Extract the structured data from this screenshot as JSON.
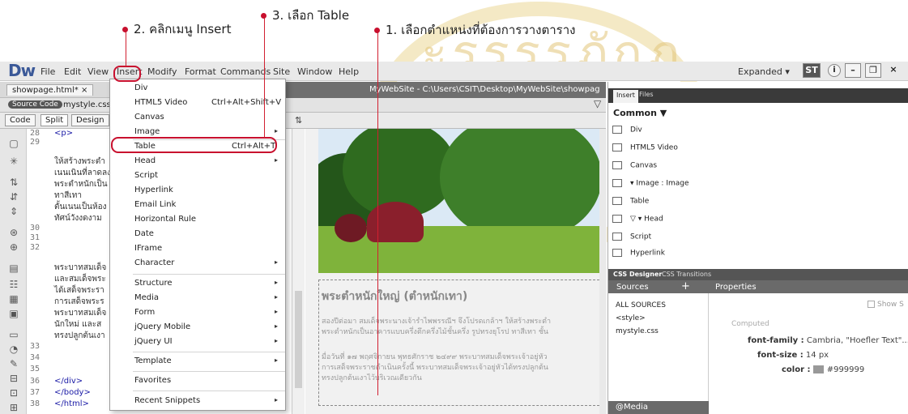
{
  "annotations": {
    "step2": "2. คลิกเมนู Insert",
    "step3": "3. เลือก Table",
    "step1": "1. เลือกตำแหน่งที่ต้องการวางตาราง"
  },
  "app": {
    "logo": "Dw",
    "menu": [
      "File",
      "Edit",
      "View",
      "Insert",
      "Modify",
      "Format",
      "Commands",
      "Site",
      "Window",
      "Help"
    ],
    "workspace": "Expanded",
    "workspace_arrow": "▾",
    "badge": "ST"
  },
  "doc": {
    "tab": "showpage.html*",
    "tab_close": "×",
    "path": "MyWebSite - C:\\Users\\CSIT\\Desktop\\MyWebSite\\showpage.html",
    "source_badge": "Source Code",
    "css_link": "mystyle.css"
  },
  "views": [
    "Code",
    "Split",
    "Design"
  ],
  "code": {
    "lines": [
      {
        "n": "28",
        "t": "<p>"
      },
      {
        "n": "29",
        "t": ""
      },
      {
        "n": "",
        "t": "ให้สร้างพระตำ"
      },
      {
        "n": "",
        "t": "เนนเนินที่ลาดลง"
      },
      {
        "n": "",
        "t": "พระตำหนักเป็น"
      },
      {
        "n": "",
        "t": "ทาสีเทา"
      },
      {
        "n": "",
        "t": "ตั้นเนนเป็นห้อง"
      },
      {
        "n": "",
        "t": "ทัศน์วังงดงาม"
      },
      {
        "n": "30",
        "t": ""
      },
      {
        "n": "31",
        "t": ""
      },
      {
        "n": "32",
        "t": ""
      },
      {
        "n": "",
        "t": "พระบาทสมเด็จ"
      },
      {
        "n": "",
        "t": "และสมเด็จพระ"
      },
      {
        "n": "",
        "t": "ได้เสด็จพระรา"
      },
      {
        "n": "",
        "t": "การเสด็จพระร"
      },
      {
        "n": "",
        "t": "พระบาทสมเด็จ"
      },
      {
        "n": "",
        "t": "นักใหม่ และส"
      },
      {
        "n": "",
        "t": "ทรงปลูกต้นเงา"
      },
      {
        "n": "33",
        "t": ""
      },
      {
        "n": "34",
        "t": ""
      },
      {
        "n": "35",
        "t": ""
      },
      {
        "n": "36",
        "t": "</div>"
      },
      {
        "n": "37",
        "t": "</body>"
      },
      {
        "n": "38",
        "t": "</html>"
      }
    ]
  },
  "menu_items": [
    {
      "label": "Div",
      "shortcut": "",
      "arrow": ""
    },
    {
      "label": "HTML5 Video",
      "shortcut": "Ctrl+Alt+Shift+V",
      "arrow": ""
    },
    {
      "label": "Canvas",
      "shortcut": "",
      "arrow": ""
    },
    {
      "label": "Image",
      "shortcut": "",
      "arrow": "▸"
    },
    {
      "label": "Table",
      "shortcut": "Ctrl+Alt+T",
      "arrow": ""
    },
    {
      "label": "Head",
      "shortcut": "",
      "arrow": "▸"
    },
    {
      "label": "Script",
      "shortcut": "",
      "arrow": ""
    },
    {
      "label": "Hyperlink",
      "shortcut": "",
      "arrow": ""
    },
    {
      "label": "Email Link",
      "shortcut": "",
      "arrow": ""
    },
    {
      "label": "Horizontal Rule",
      "shortcut": "",
      "arrow": ""
    },
    {
      "label": "Date",
      "shortcut": "",
      "arrow": ""
    },
    {
      "label": "IFrame",
      "shortcut": "",
      "arrow": ""
    },
    {
      "label": "Character",
      "shortcut": "",
      "arrow": "▸"
    },
    {
      "label": "Structure",
      "shortcut": "",
      "arrow": "▸"
    },
    {
      "label": "Media",
      "shortcut": "",
      "arrow": "▸"
    },
    {
      "label": "Form",
      "shortcut": "",
      "arrow": "▸"
    },
    {
      "label": "jQuery Mobile",
      "shortcut": "",
      "arrow": "▸"
    },
    {
      "label": "jQuery UI",
      "shortcut": "",
      "arrow": "▸"
    },
    {
      "label": "Template",
      "shortcut": "",
      "arrow": "▸"
    },
    {
      "label": "Favorites",
      "shortcut": "",
      "arrow": ""
    },
    {
      "label": "Recent Snippets",
      "shortcut": "",
      "arrow": "▸"
    }
  ],
  "design": {
    "heading": "พระตำหนักใหญ่ (ตำหนักเทา)",
    "para1a": "สองปีต่อมา สมเด็จพระนางเจ้ารำไพพรรณีฯ จึงโปรดเกล้าฯ ให้สร้างพระตำ",
    "para1b": "พระตำหนักเป็นอาคารแบบครึ่งตึกครึ่งไม้ชั้นครึ่ง รูปทรงยุโรป ทาสีเทา ชั้น",
    "para2a": "มื่อวันที่ ๑๗ พฤศจิกายน พุทธศักราช ๒๔๙๙ พระบาทสมเด็จพระเจ้าอยู่หัว",
    "para2b": "การเสด็จพระราชดำเนินครั้งนี้ พระบาทสมเด็จพระเจ้าอยู่หัวได้ทรงปลูกต้น",
    "para2c": "ทรงปลูกต้นเงาไว้บริเวณเดียวกัน"
  },
  "insert_panel": {
    "tabs": [
      "Insert",
      "Files"
    ],
    "category": "Common ▼",
    "items": [
      "Div",
      "HTML5 Video",
      "Canvas",
      "▾ Image : Image",
      "Table",
      "▽ ▾ Head",
      "Script",
      "Hyperlink"
    ]
  },
  "css_panel": {
    "tabs": [
      "CSS Designer",
      "CSS Transitions"
    ],
    "sources_title": "Sources",
    "plus": "+",
    "properties_title": "Properties",
    "sources": [
      "ALL SOURCES",
      "<style>",
      "mystyle.css"
    ],
    "media": "@Media",
    "show_set": "Show S",
    "computed": "Computed",
    "props": [
      {
        "name": "font-family :",
        "value": "Cambria, \"Hoefler Text\"..."
      },
      {
        "name": "font-size :",
        "value": "14 px"
      },
      {
        "name": "color :",
        "value": "#999999"
      }
    ]
  },
  "colors": {
    "accent": "#c8102e",
    "swatch": "#999999"
  }
}
